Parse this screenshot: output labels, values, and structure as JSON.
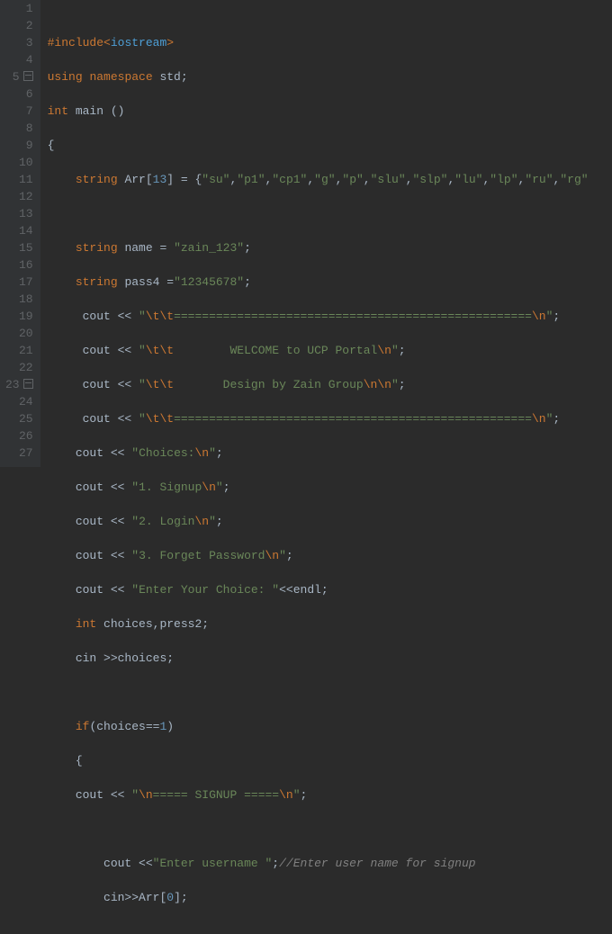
{
  "lines": {
    "start": 1,
    "end": 27
  },
  "code": {
    "l1": {
      "include": "#include",
      "lt": "<",
      "header": "iostream",
      "gt": ">"
    },
    "l2": {
      "using": "using",
      "namespace": "namespace",
      "std": " std;"
    },
    "l3": {
      "int": "int",
      "main": " main ()"
    },
    "l4": {
      "brace": "{"
    },
    "l5": {
      "type": "string",
      "name": " Arr[",
      "num": "13",
      "rest": "] = {",
      "s0": "\"su\"",
      "c": ",",
      "s1": "\"p1\"",
      "s2": "\"cp1\"",
      "s3": "\"g\"",
      "s4": "\"p\"",
      "s5": "\"slu\"",
      "s6": "\"slp\"",
      "s7": "\"lu\"",
      "s8": "\"lp\"",
      "s9": "\"ru\"",
      "s10": "\"rg\""
    },
    "l7": {
      "type": "string",
      "decl": " name = ",
      "val": "\"zain_123\"",
      "semi": ";"
    },
    "l8": {
      "type": "string",
      "decl": " pass4 =",
      "val": "\"12345678\"",
      "semi": ";"
    },
    "l9": {
      "cout": "cout << ",
      "q": "\"",
      "e1": "\\t\\t",
      "bar": "===================================================",
      "e2": "\\n",
      "semi": ";"
    },
    "l10": {
      "cout": "cout << ",
      "q": "\"",
      "e1": "\\t\\t",
      "txt": "        WELCOME to UCP Portal",
      "e2": "\\n",
      "semi": ";"
    },
    "l11": {
      "cout": "cout << ",
      "q": "\"",
      "e1": "\\t\\t",
      "txt": "       Design by Zain Group",
      "e2": "\\n\\n",
      "semi": ";"
    },
    "l12": {
      "cout": "cout << ",
      "q": "\"",
      "e1": "\\t\\t",
      "bar": "===================================================",
      "e2": "\\n",
      "semi": ";"
    },
    "l13": {
      "cout": "cout << ",
      "q": "\"",
      "txt": "Choices:",
      "e": "\\n",
      "semi": ";"
    },
    "l14": {
      "cout": "cout << ",
      "q": "\"",
      "txt": "1. Signup",
      "e": "\\n",
      "semi": ";"
    },
    "l15": {
      "cout": "cout << ",
      "q": "\"",
      "txt": "2. Login",
      "e": "\\n",
      "semi": ";"
    },
    "l16": {
      "cout": "cout << ",
      "q": "\"",
      "txt": "3. Forget Password",
      "e": "\\n",
      "semi": ";"
    },
    "l17": {
      "cout": "cout << ",
      "q": "\"",
      "txt": "Enter Your Choice: ",
      "endl": "<<endl;"
    },
    "l18": {
      "int": "int",
      "rest": " choices,press2;"
    },
    "l19": {
      "cin": "cin >>choices;"
    },
    "l21": {
      "if": "if",
      "rest": "(choices==",
      "num": "1",
      "close": ")"
    },
    "l22": {
      "brace": "{"
    },
    "l23": {
      "cout": "cout << ",
      "q": "\"",
      "e1": "\\n",
      "txt": "===== SIGNUP =====",
      "e2": "\\n",
      "semi": ";"
    },
    "l25": {
      "cout": "cout <<",
      "q": "\"",
      "txt": "Enter username ",
      "semi": ";",
      "comment": "//Enter user name for signup"
    },
    "l26": {
      "cin": "cin>>Arr[",
      "num": "0",
      "close": "];"
    }
  }
}
